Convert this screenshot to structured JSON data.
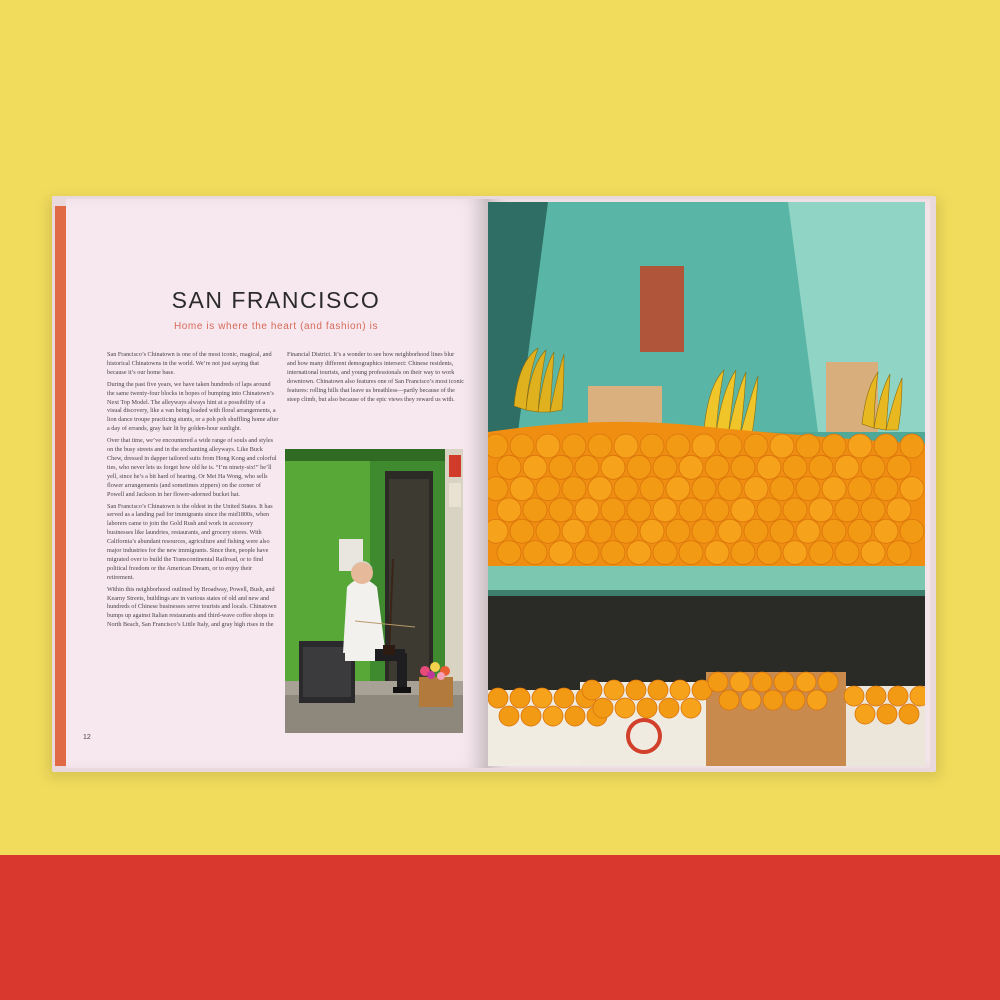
{
  "colors": {
    "background_yellow": "#f1dc5c",
    "background_red": "#d8382e",
    "page_pink": "#f6e8ee",
    "accent_coral": "#d66a5a",
    "spine_orange": "#e06a45"
  },
  "book": {
    "left_page": {
      "title": "SAN FRANCISCO",
      "subtitle": "Home is where the heart (and fashion) is",
      "column1": [
        "San Francisco’s Chinatown is one of the most iconic, magical, and historical Chinatowns in the world. We’re not just saying that because it’s our home base.",
        "During the past five years, we have taken hundreds of laps around the same twenty-four blocks in hopes of bumping into Chinatown’s Next Top Model. The alleyways always hint at a possibility of a visual discovery, like a van being loaded with floral arrangements, a lion dance troupe practicing stunts, or a poh poh shuffling home after a day of errands, gray hair lit by golden-hour sunlight.",
        "Over that time, we’ve encountered a wide range of souls and styles on the busy streets and in the enchanting alleyways. Like Buck Chew, dressed in dapper tailored suits from Hong Kong and colorful ties, who never lets us forget how old he is. “I’m ninety-six!” he’ll yell, since he’s a bit hard of hearing. Or Mei Ha Wong, who sells flower arrangements (and sometimes zippers) on the corner of Powell and Jackson in her flower-adorned bucket hat.",
        "San Francisco’s Chinatown is the oldest in the United States. It has served as a landing pad for immigrants since the mid1800s, when laborers came to join the Gold Rush and work in accessory businesses like laundries, restaurants, and grocery stores. With California’s abundant resources, agriculture and fishing were also major industries for the new immigrants. Since then, people have migrated over to build the Transcontinental Railroad, or to find political freedom or the American Dream, or to enjoy their retirement.",
        "Within this neighborhood outlined by Broadway, Powell, Bush, and Kearny Streets, buildings are in various states of old and new and hundreds of Chinese businesses serve tourists and locals. Chinatown bumps up against Italian restaurants and third-wave coffee shops in North Beach, San Francisco’s Little Italy, and gray high rises in the"
      ],
      "column2": [
        "Financial District. It’s a wonder to see how neighborhood lines blur and how many different demographics intersect: Chinese residents, international tourists, and young professionals on their way to work downtown. Chinatown also features one of San Francisco’s most iconic features: rolling hills that leave us breathless—partly because of the steep climb, but also because of the epic views they reward us with."
      ],
      "page_number": "12"
    }
  }
}
